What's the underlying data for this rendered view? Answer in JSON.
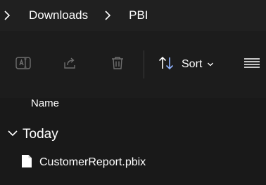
{
  "breadcrumb": {
    "items": [
      {
        "label": "Downloads"
      },
      {
        "label": "PBI"
      }
    ]
  },
  "toolbar": {
    "sort_label": "Sort",
    "icons": [
      "rename-icon",
      "share-icon",
      "delete-icon",
      "sort-icon",
      "chevron-down-icon",
      "view-options-icon"
    ],
    "disabled_color": "#6e6e6e",
    "sort_icon_color": "#8fb3ff"
  },
  "list": {
    "column_name": "Name",
    "groups": [
      {
        "label": "Today",
        "files": [
          {
            "name": "CustomerReport.pbix",
            "icon": "file-icon"
          }
        ]
      }
    ]
  },
  "colors": {
    "background": "#191919",
    "header_background": "#202020",
    "text": "#ffffff"
  }
}
